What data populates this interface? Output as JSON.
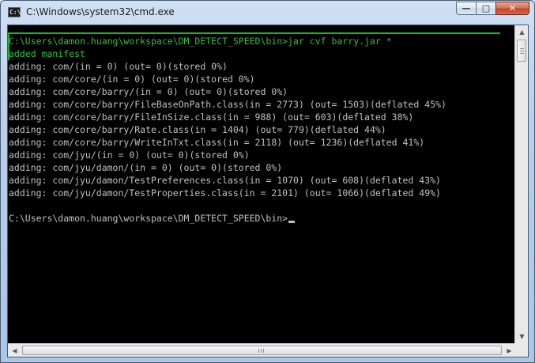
{
  "window": {
    "title": "C:\\Windows\\system32\\cmd.exe",
    "icon_label": "C:\\",
    "controls": {
      "minimize": "—",
      "maximize": "□",
      "close": "✕"
    }
  },
  "console": {
    "prompt_path": "C:\\Users\\damon.huang\\workspace\\DM_DETECT_SPEED\\bin>",
    "command": "jar cvf barry.jar *",
    "lines": [
      "added manifest",
      "adding: com/(in = 0) (out= 0)(stored 0%)",
      "adding: com/core/(in = 0) (out= 0)(stored 0%)",
      "adding: com/core/barry/(in = 0) (out= 0)(stored 0%)",
      "adding: com/core/barry/FileBaseOnPath.class(in = 2773) (out= 1503)(deflated 45%)",
      "adding: com/core/barry/FileInSize.class(in = 988) (out= 603)(deflated 38%)",
      "adding: com/core/barry/Rate.class(in = 1404) (out= 779)(deflated 44%)",
      "adding: com/core/barry/WriteInTxt.class(in = 2118) (out= 1236)(deflated 41%)",
      "adding: com/jyu/(in = 0) (out= 0)(stored 0%)",
      "adding: com/jyu/damon/(in = 0) (out= 0)(stored 0%)",
      "adding: com/jyu/damon/TestPreferences.class(in = 1070) (out= 608)(deflated 43%)",
      "adding: com/jyu/damon/TestProperties.class(in = 2101) (out= 1066)(deflated 49%)"
    ],
    "final_prompt": "C:\\Users\\damon.huang\\workspace\\DM_DETECT_SPEED\\bin>",
    "text_color": "#c0c0c0",
    "highlight_color": "#18b72a"
  },
  "scrollbars": {
    "up_arrow": "▲",
    "down_arrow": "▼",
    "left_arrow": "◀",
    "right_arrow": "▶"
  }
}
